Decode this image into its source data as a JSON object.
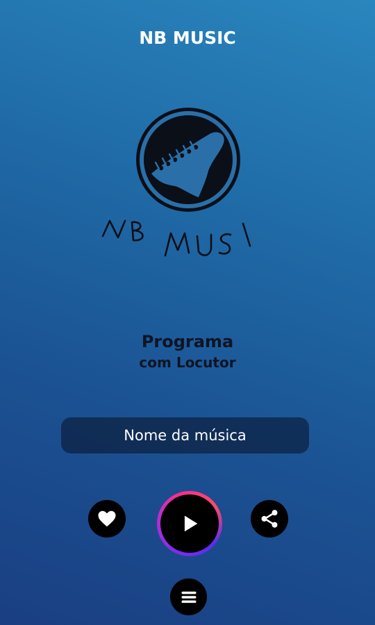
{
  "header": {
    "title": "NB MUSIC"
  },
  "logo": {
    "icon": "guitar-headstock-logo",
    "handwritten_text": "NB MUSI"
  },
  "program": {
    "title": "Programa",
    "subtitle": "com Locutor"
  },
  "now_playing": {
    "song_name": "Nome da música"
  },
  "controls": {
    "favorite_icon": "heart-icon",
    "play_icon": "play-icon",
    "share_icon": "share-icon",
    "menu_icon": "menu-icon"
  },
  "colors": {
    "background_top": "#2a86be",
    "background_bottom": "#1a3f82",
    "play_ring_start": "#7a2cf0",
    "play_ring_end": "#ff2e8a"
  }
}
